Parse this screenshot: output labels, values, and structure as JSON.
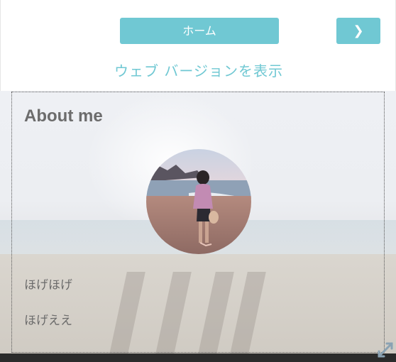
{
  "nav": {
    "home_label": "ホーム",
    "next_label": "❯",
    "web_version_label": "ウェブ バージョンを表示"
  },
  "about": {
    "title": "About me",
    "lines": [
      "ほげほげ",
      "ほげええ"
    ]
  },
  "colors": {
    "accent": "#70c8d3",
    "text": "#6a6a6a"
  },
  "icons": {
    "next": "chevron-right-icon",
    "corner": "expand-icon"
  }
}
